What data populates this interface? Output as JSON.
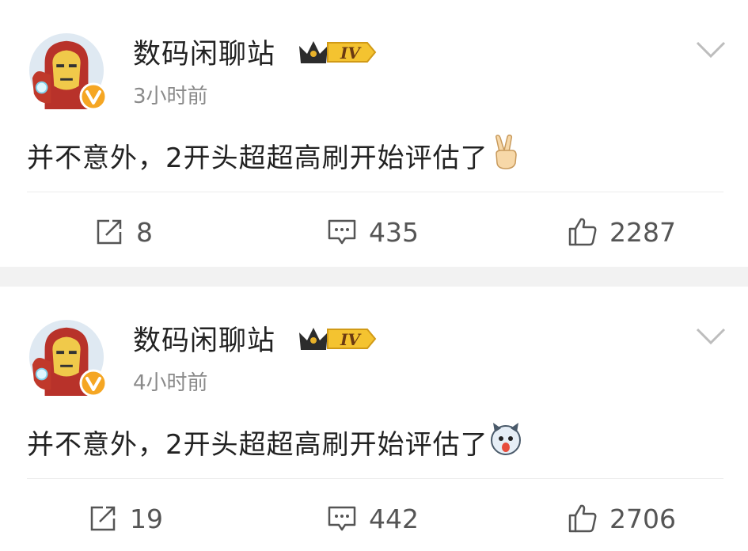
{
  "posts": [
    {
      "author": "数码闲聊站",
      "level_badge": "IV",
      "time": "3小时前",
      "text": "并不意外，2开头超超高刷开始评估了",
      "emoji": "victory-hand-emoji",
      "reposts": "8",
      "comments": "435",
      "likes": "2287"
    },
    {
      "author": "数码闲聊站",
      "level_badge": "IV",
      "time": "4小时前",
      "text": "并不意外，2开头超超高刷开始评估了",
      "emoji": "husky-dog-emoji",
      "reposts": "19",
      "comments": "442",
      "likes": "2706"
    }
  ],
  "icons": {
    "repost": "repost-icon",
    "comment": "comment-icon",
    "like": "like-thumb-icon",
    "more": "chevron-down-icon",
    "verified": "verified-v-badge-icon"
  },
  "colors": {
    "verified_badge": "#f5a623",
    "crown_gold": "#e8b22a",
    "background_gap": "#f2f2f2",
    "secondary_text": "#8a8a8a"
  }
}
